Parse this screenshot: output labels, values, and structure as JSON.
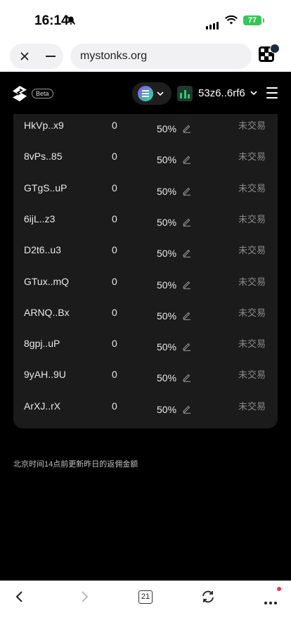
{
  "status_bar": {
    "time": "16:14",
    "battery": "77"
  },
  "browser": {
    "url": "mystonks.org",
    "tab_count": "21"
  },
  "app_header": {
    "beta_label": "Beta",
    "wallet_address": "53z6..6rf6"
  },
  "rows": [
    {
      "address": "HkVp..x9",
      "count": "0",
      "percent": "50%",
      "status": "未交易"
    },
    {
      "address": "8vPs..85",
      "count": "0",
      "percent": "50%",
      "status": "未交易"
    },
    {
      "address": "GTgS..uP",
      "count": "0",
      "percent": "50%",
      "status": "未交易"
    },
    {
      "address": "6ijL..z3",
      "count": "0",
      "percent": "50%",
      "status": "未交易"
    },
    {
      "address": "D2t6..u3",
      "count": "0",
      "percent": "50%",
      "status": "未交易"
    },
    {
      "address": "GTux..mQ",
      "count": "0",
      "percent": "50%",
      "status": "未交易"
    },
    {
      "address": "ARNQ..Bx",
      "count": "0",
      "percent": "50%",
      "status": "未交易"
    },
    {
      "address": "8gpj..uP",
      "count": "0",
      "percent": "50%",
      "status": "未交易"
    },
    {
      "address": "9yAH..9U",
      "count": "0",
      "percent": "50%",
      "status": "未交易"
    },
    {
      "address": "ArXJ..rX",
      "count": "0",
      "percent": "50%",
      "status": "未交易"
    }
  ],
  "footnote": "北京时间14点前更新昨日的返佣金额",
  "icons": {
    "bell": "bell-slash-icon",
    "close": "close-icon",
    "minimize": "minimize-icon",
    "edit": "pencil-icon",
    "back": "chevron-left-icon",
    "forward": "chevron-right-icon",
    "reload": "reload-icon",
    "more": "more-icon"
  },
  "colors": {
    "background": "#000000",
    "card": "#1b1b1b",
    "status_text": "#8a8a8a",
    "battery": "#34c759"
  }
}
